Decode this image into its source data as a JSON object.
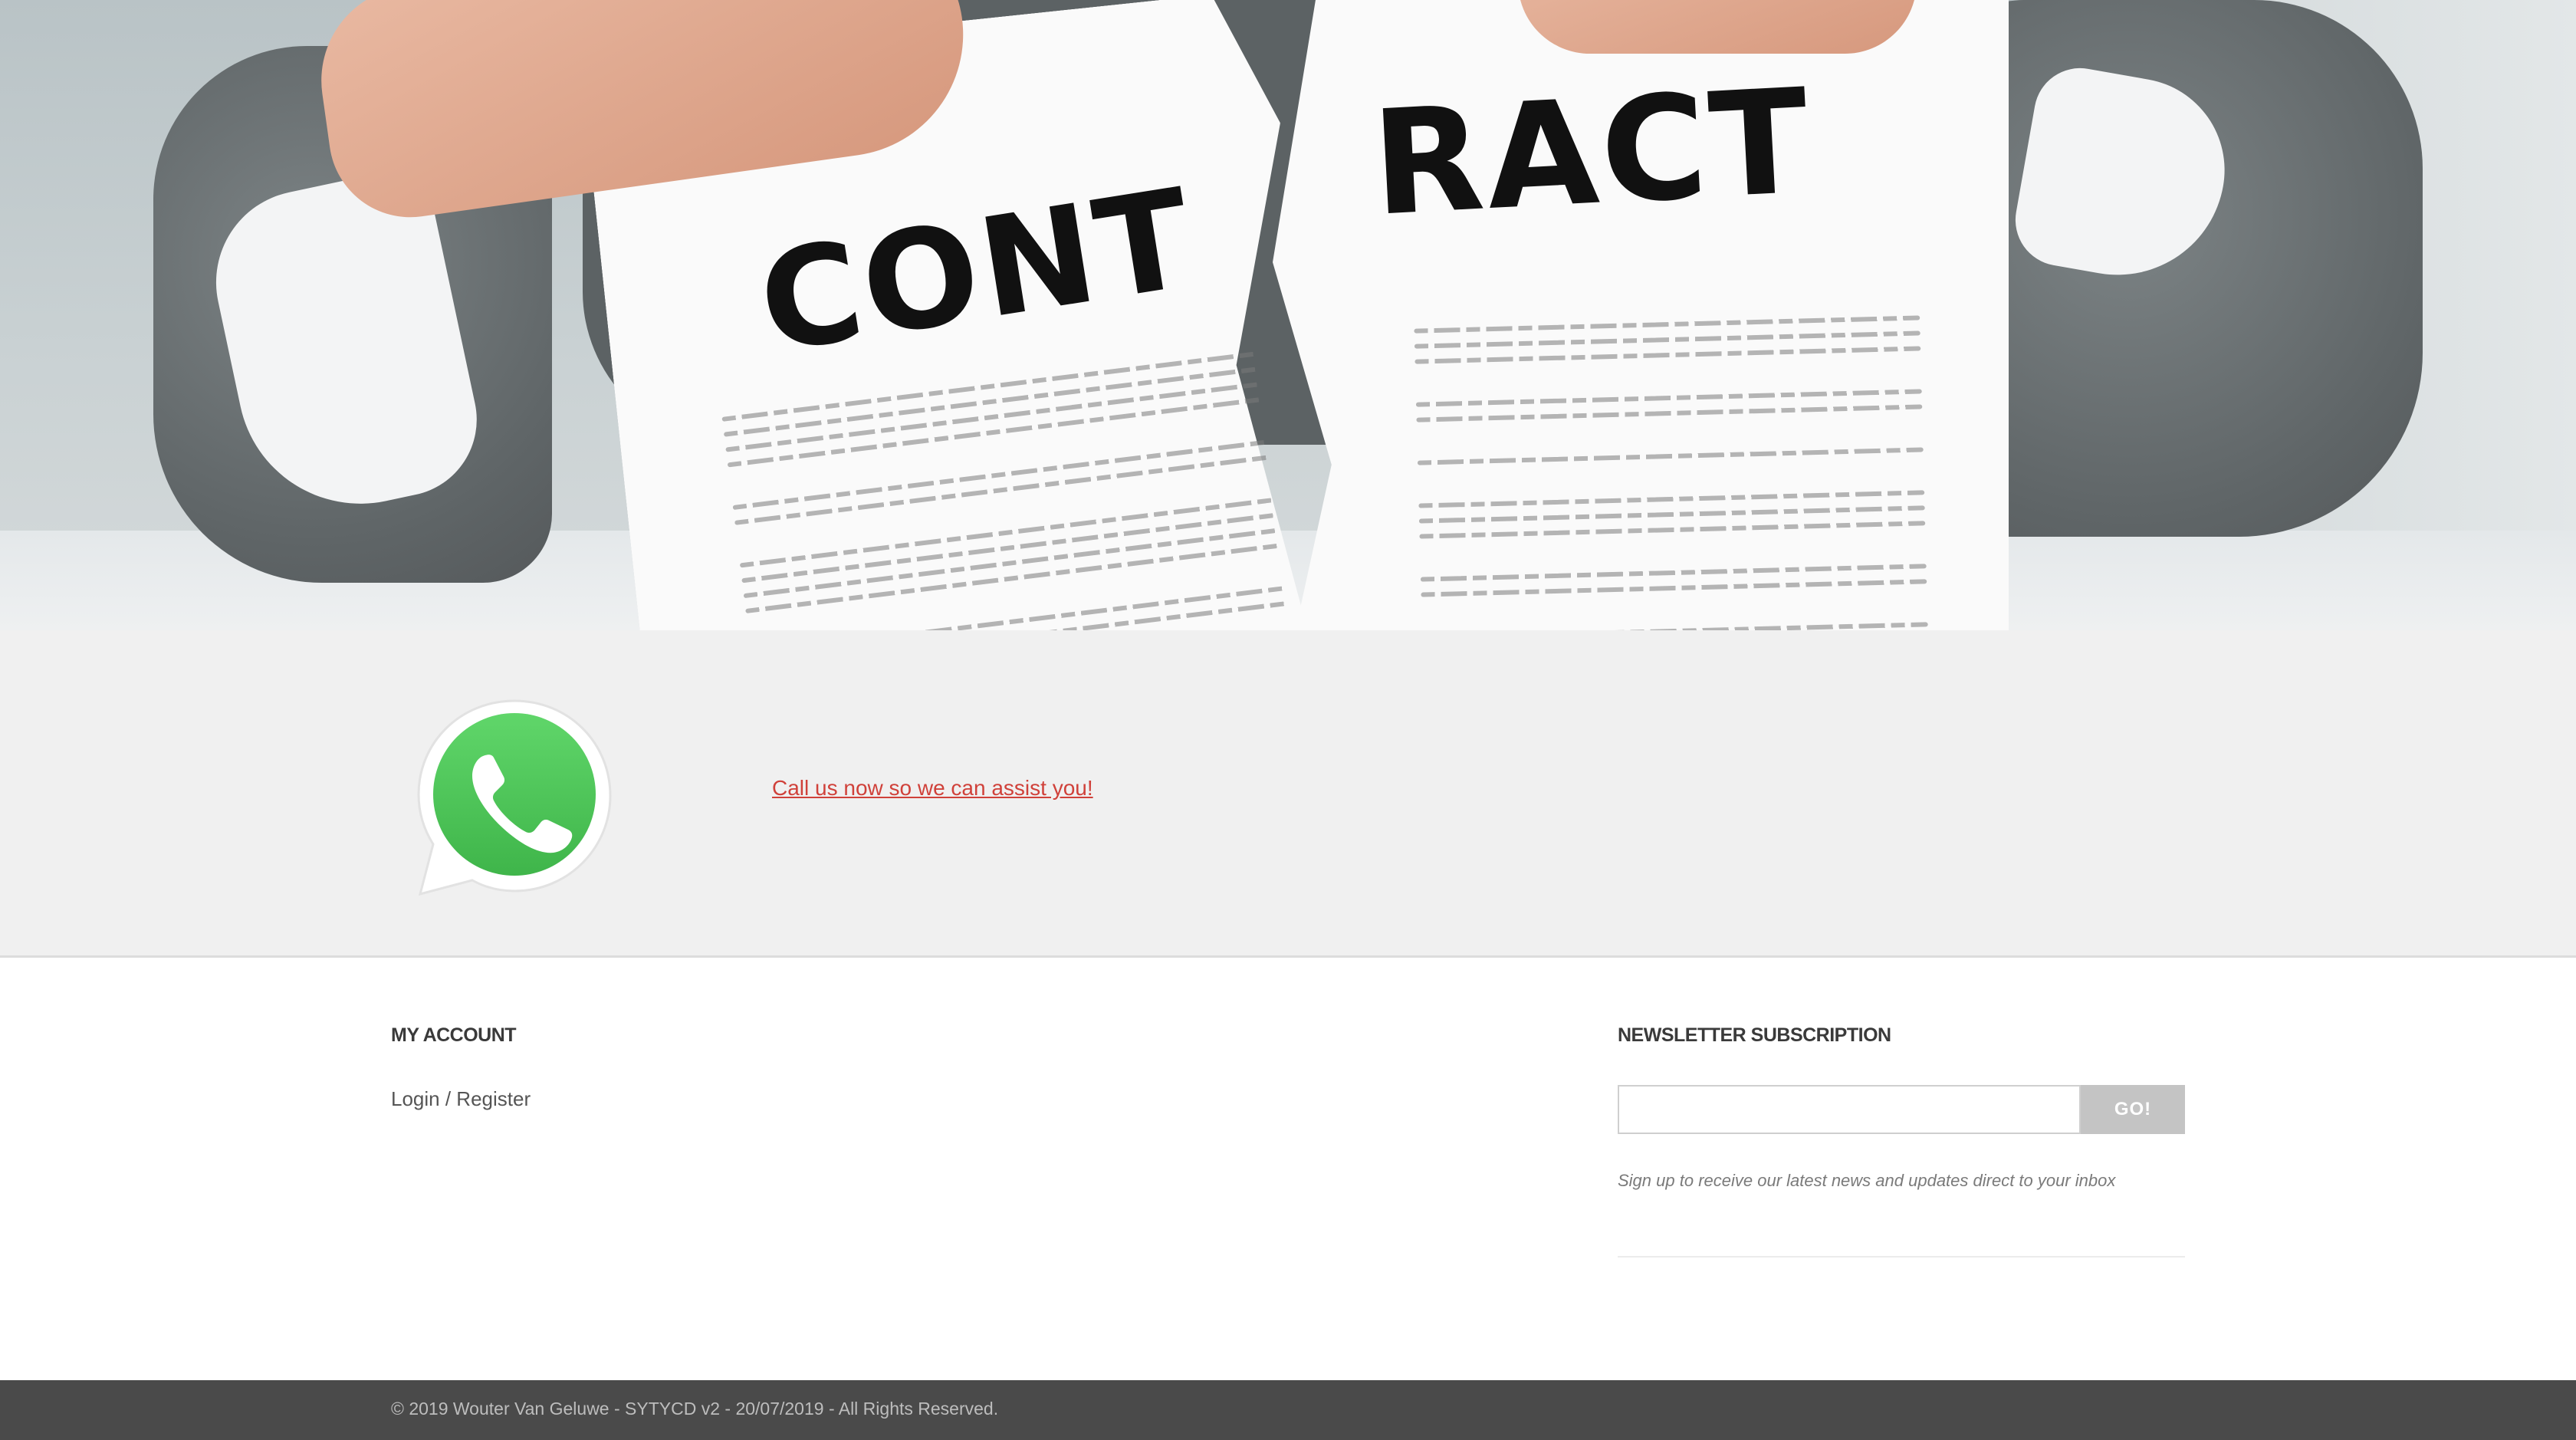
{
  "hero": {
    "word_left": "CONT",
    "word_right": "RACT",
    "alt_icon": "torn-contract-photo"
  },
  "call": {
    "icon": "whatsapp-icon",
    "link_text": "Call us now so we can assist you!",
    "link_color": "#d0413a"
  },
  "account": {
    "title": "MY ACCOUNT",
    "login_label": "Login / Register"
  },
  "newsletter": {
    "title": "NEWSLETTER SUBSCRIPTION",
    "input_value": "",
    "button_label": "GO!",
    "help_text": "Sign up to receive our latest news and updates direct to your inbox"
  },
  "footer": {
    "copyright": "© 2019 Wouter Van Geluwe - SYTYCD v2 - 20/07/2019 - All Rights Reserved."
  },
  "colors": {
    "band_bg": "#f0f0f0",
    "bottom_bar": "#4a4a4a",
    "whatsapp_green": "#4fc557"
  }
}
